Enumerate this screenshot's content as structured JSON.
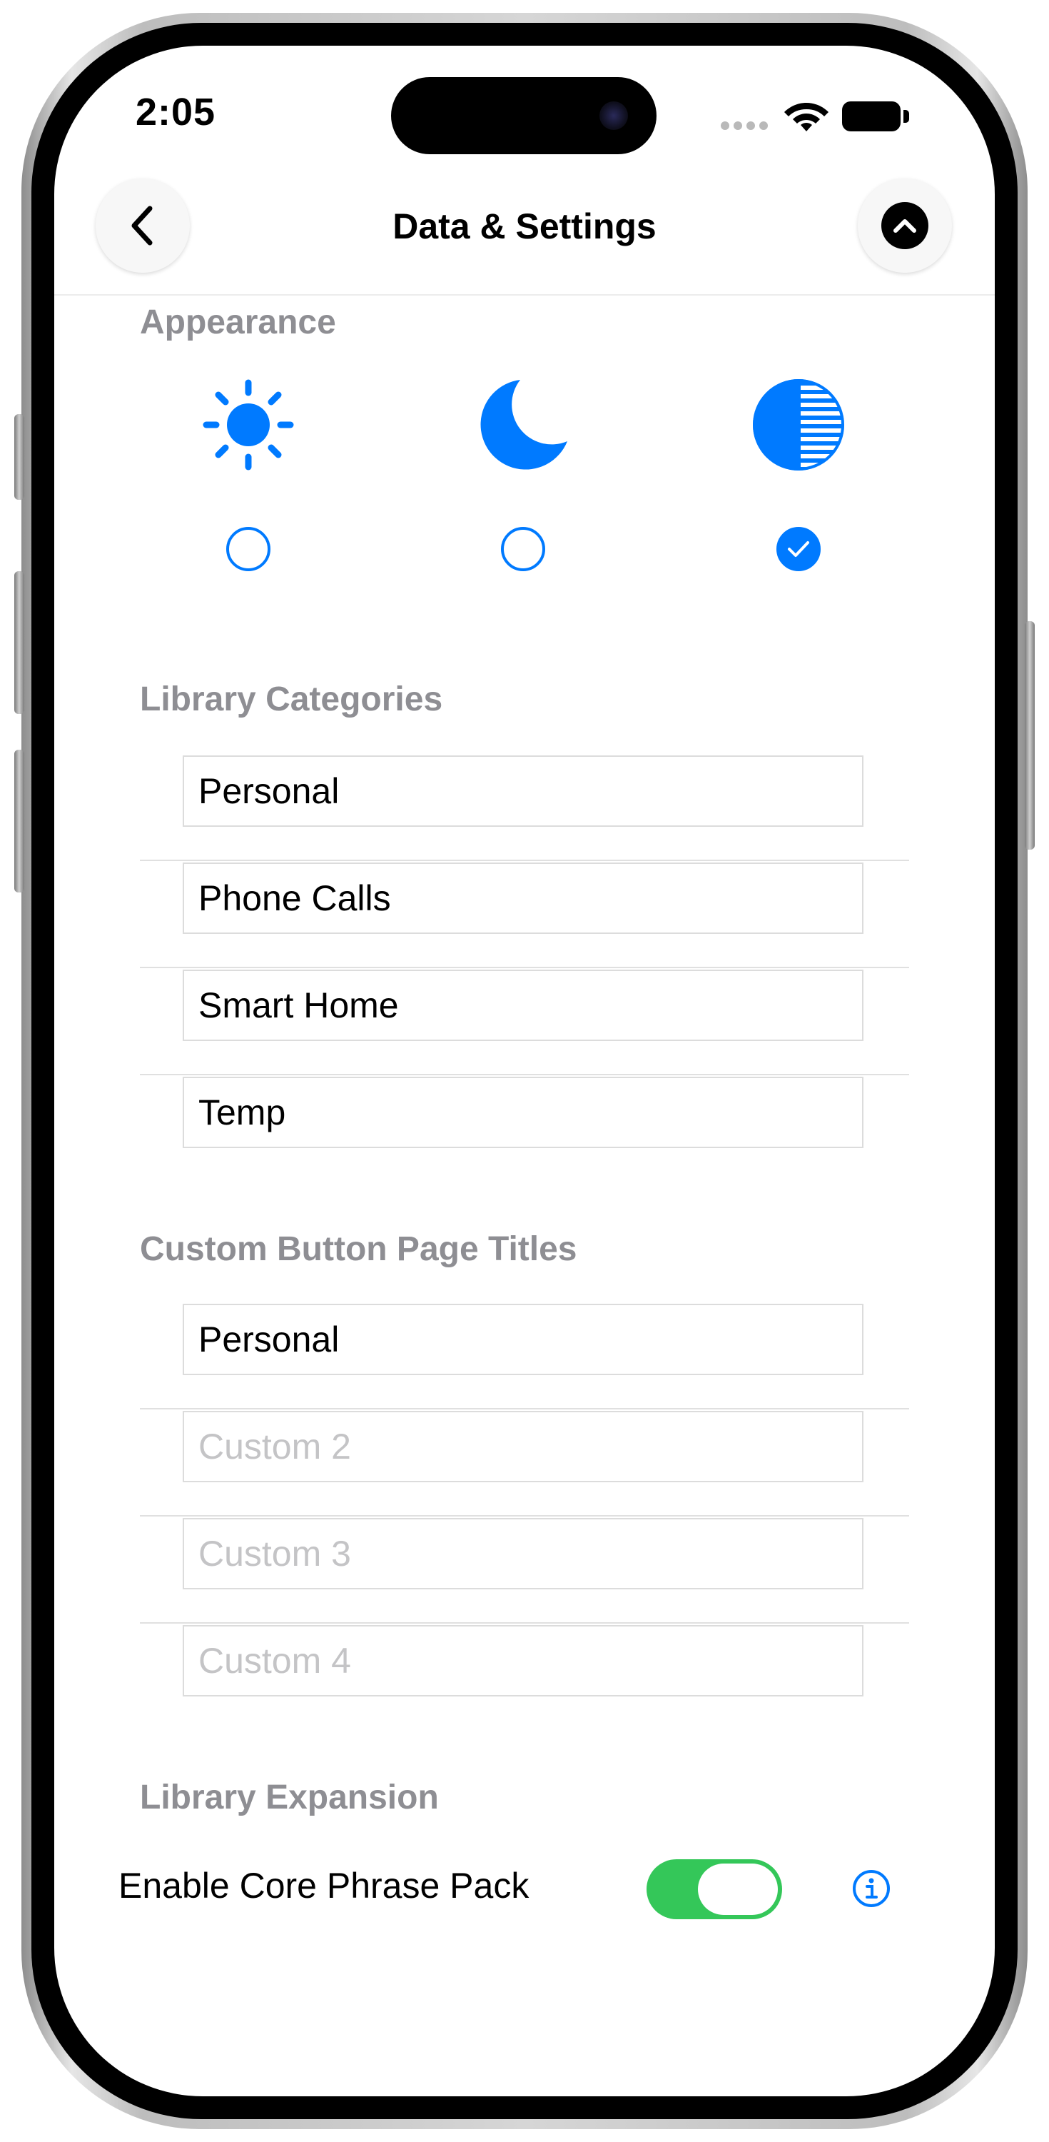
{
  "status_bar": {
    "time": "2:05"
  },
  "nav": {
    "title": "Data & Settings",
    "back_icon": "chevron-left-icon",
    "up_icon": "chevron-up-circle-icon"
  },
  "appearance": {
    "header": "Appearance",
    "options": [
      {
        "name": "light",
        "icon": "sun-icon",
        "selected": false
      },
      {
        "name": "dark",
        "icon": "moon-icon",
        "selected": false
      },
      {
        "name": "automatic",
        "icon": "half-circle-icon",
        "selected": true
      }
    ]
  },
  "library_categories": {
    "header": "Library Categories",
    "fields": [
      {
        "value": "Personal",
        "placeholder": ""
      },
      {
        "value": "Phone Calls",
        "placeholder": ""
      },
      {
        "value": "Smart Home",
        "placeholder": ""
      },
      {
        "value": "Temp",
        "placeholder": ""
      }
    ]
  },
  "custom_button_page_titles": {
    "header": "Custom Button Page Titles",
    "fields": [
      {
        "value": "Personal",
        "placeholder": ""
      },
      {
        "value": "",
        "placeholder": "Custom 2"
      },
      {
        "value": "",
        "placeholder": "Custom 3"
      },
      {
        "value": "",
        "placeholder": "Custom 4"
      }
    ]
  },
  "library_expansion": {
    "header": "Library Expansion",
    "toggle_label": "Enable Core Phrase Pack",
    "toggle_on": true,
    "info_icon": "info-circle-icon"
  },
  "colors": {
    "accent": "#007AFF",
    "toggle_on": "#34C759",
    "section_header": "#8E8E93",
    "placeholder": "#C4C4C6"
  }
}
